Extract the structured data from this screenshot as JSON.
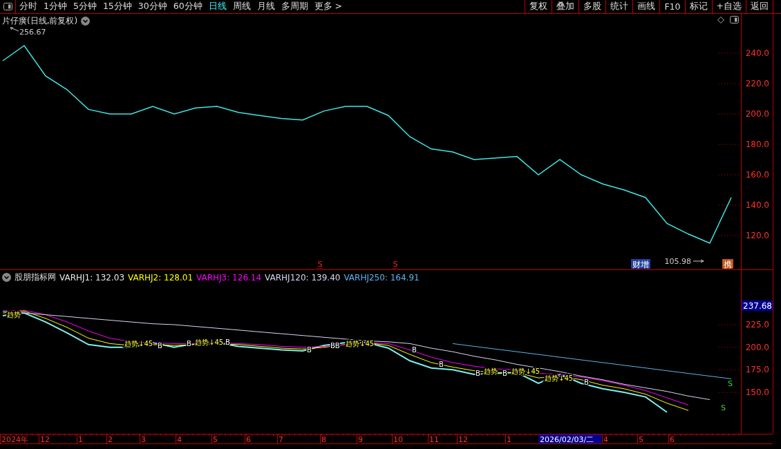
{
  "toolbar": {
    "periods": [
      {
        "label": "分时",
        "selected": false
      },
      {
        "label": "1分钟",
        "selected": false
      },
      {
        "label": "5分钟",
        "selected": false
      },
      {
        "label": "15分钟",
        "selected": false
      },
      {
        "label": "30分钟",
        "selected": false
      },
      {
        "label": "60分钟",
        "selected": false
      },
      {
        "label": "日线",
        "selected": true
      },
      {
        "label": "周线",
        "selected": false
      },
      {
        "label": "月线",
        "selected": false
      },
      {
        "label": "多周期",
        "selected": false
      },
      {
        "label": "更多 >",
        "selected": false
      }
    ],
    "buttons": [
      "复权",
      "叠加",
      "多股",
      "统计",
      "画线",
      "F10",
      "标记",
      "+自选",
      "返回"
    ]
  },
  "main_panel": {
    "title": "片仔癀(日线,前复权)",
    "y_axis_labels": [
      "240.0",
      "220.0",
      "200.0",
      "180.0",
      "160.0",
      "140.0",
      "120.0"
    ],
    "markers": [
      {
        "kind": "max",
        "text": "256.67"
      },
      {
        "kind": "signal",
        "text": "S"
      },
      {
        "kind": "signal",
        "text": "S"
      },
      {
        "kind": "badge",
        "text": "财增",
        "color": "#1f3fa0"
      },
      {
        "kind": "min",
        "text": "105.98"
      },
      {
        "kind": "badge",
        "text": "携",
        "color": "#c0561c"
      }
    ]
  },
  "indicator_panel": {
    "title": "股朋指标网",
    "legend": [
      {
        "text": "VARHJ1: 132.03",
        "color": "#e8e8e8"
      },
      {
        "text": "VARHJ2: 128.01",
        "color": "#ffff00"
      },
      {
        "text": "VARHJ3: 126.14",
        "color": "#ff00ff"
      },
      {
        "text": "VARHJ120: 139.40",
        "color": "#d8d8f0"
      },
      {
        "text": "VARHJ250: 164.91",
        "color": "#5ab4f0"
      }
    ],
    "cursor_value": "237.68",
    "y_axis_labels": [
      "225.0",
      "200.0",
      "175.0",
      "150.0"
    ],
    "markers": [
      {
        "kind": "trend",
        "text": "趋势"
      },
      {
        "kind": "trend",
        "text": "趋势↓45"
      },
      {
        "kind": "buy",
        "text": "B"
      },
      {
        "kind": "buy",
        "text": "B"
      },
      {
        "kind": "trend",
        "text": "趋势↓45"
      },
      {
        "kind": "buy",
        "text": "B"
      },
      {
        "kind": "buy",
        "text": "B"
      },
      {
        "kind": "buy",
        "text": "BB"
      },
      {
        "kind": "trend",
        "text": "趋势↓45"
      },
      {
        "kind": "buy",
        "text": "B"
      },
      {
        "kind": "buy",
        "text": "B"
      },
      {
        "kind": "buy",
        "text": "B"
      },
      {
        "kind": "trend",
        "text": "趋势"
      },
      {
        "kind": "buy",
        "text": "B"
      },
      {
        "kind": "trend",
        "text": "趋势↓45"
      },
      {
        "kind": "trend",
        "text": "趋势↓45"
      },
      {
        "kind": "buy",
        "text": "B"
      },
      {
        "kind": "sell",
        "text": "S"
      },
      {
        "kind": "sell",
        "text": "S"
      }
    ]
  },
  "time_axis": {
    "labels": [
      "2024年",
      "12",
      "1",
      "2",
      "3",
      "4",
      "5",
      "6",
      "7",
      "8",
      "9",
      "10",
      "11",
      "12",
      "1",
      "4",
      "5",
      "6"
    ],
    "cursor_date": "2026/02/03/二"
  }
}
